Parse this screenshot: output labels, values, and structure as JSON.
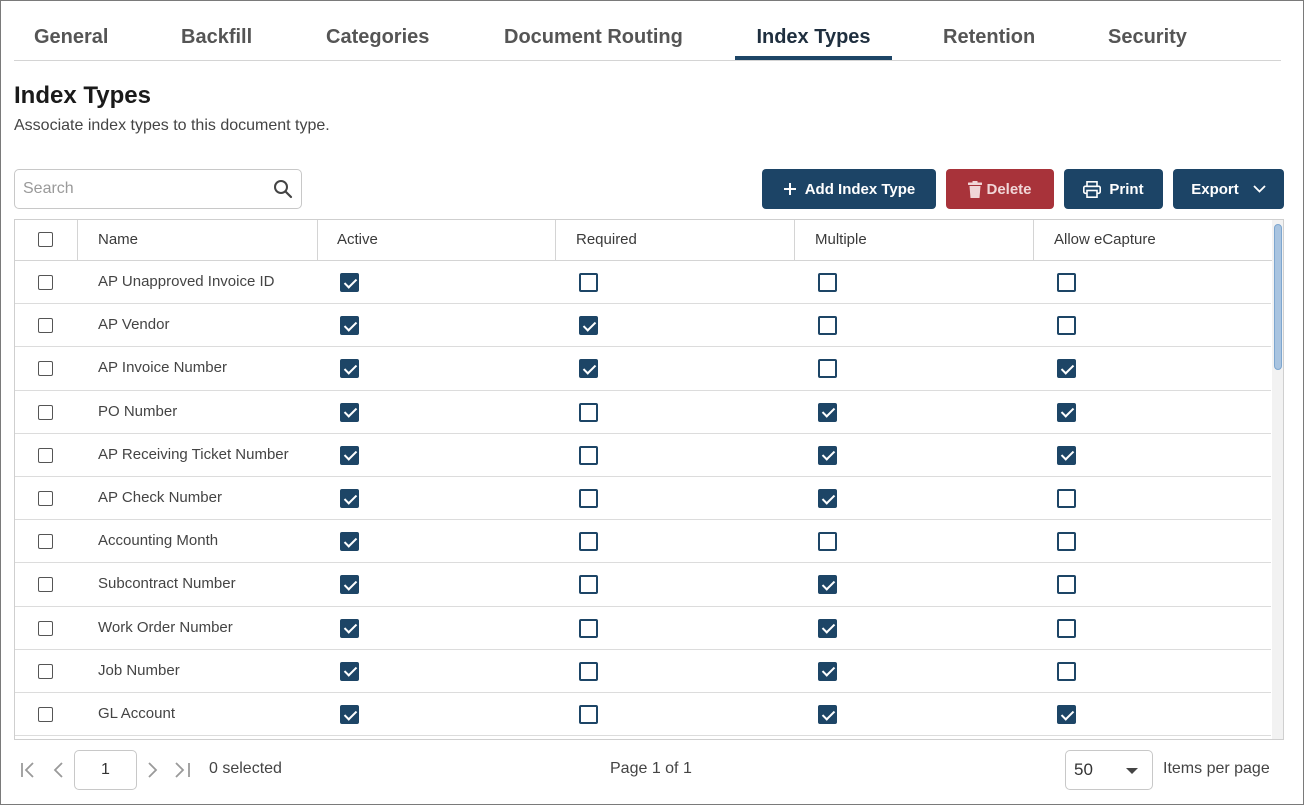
{
  "tabs": [
    {
      "label": "General",
      "active": false
    },
    {
      "label": "Backfill",
      "active": false
    },
    {
      "label": "Categories",
      "active": false
    },
    {
      "label": "Document Routing",
      "active": false
    },
    {
      "label": "Index Types",
      "active": true
    },
    {
      "label": "Retention",
      "active": false
    },
    {
      "label": "Security",
      "active": false
    }
  ],
  "header": {
    "title": "Index Types",
    "subtitle": "Associate index types to this document type."
  },
  "search": {
    "placeholder": "Search",
    "value": "",
    "icon": "search-icon"
  },
  "toolbar": {
    "add_label": "Add Index Type",
    "delete_label": "Delete",
    "print_label": "Print",
    "export_label": "Export"
  },
  "colors": {
    "primary": "#1c4466",
    "danger": "#a8333a",
    "checkbox": "#1d4566"
  },
  "grid": {
    "columns": [
      "Name",
      "Active",
      "Required",
      "Multiple",
      "Allow eCapture"
    ],
    "rows": [
      {
        "name": "AP Unapproved Invoice ID",
        "active": true,
        "required": false,
        "multiple": false,
        "ecapture": false
      },
      {
        "name": "AP Vendor",
        "active": true,
        "required": true,
        "multiple": false,
        "ecapture": false
      },
      {
        "name": "AP Invoice Number",
        "active": true,
        "required": true,
        "multiple": false,
        "ecapture": true
      },
      {
        "name": "PO Number",
        "active": true,
        "required": false,
        "multiple": true,
        "ecapture": true
      },
      {
        "name": "AP Receiving Ticket Number",
        "active": true,
        "required": false,
        "multiple": true,
        "ecapture": true
      },
      {
        "name": "AP Check Number",
        "active": true,
        "required": false,
        "multiple": true,
        "ecapture": false
      },
      {
        "name": "Accounting Month",
        "active": true,
        "required": false,
        "multiple": false,
        "ecapture": false
      },
      {
        "name": "Subcontract Number",
        "active": true,
        "required": false,
        "multiple": true,
        "ecapture": false
      },
      {
        "name": "Work Order Number",
        "active": true,
        "required": false,
        "multiple": true,
        "ecapture": false
      },
      {
        "name": "Job Number",
        "active": true,
        "required": false,
        "multiple": true,
        "ecapture": false
      },
      {
        "name": "GL Account",
        "active": true,
        "required": false,
        "multiple": true,
        "ecapture": true
      }
    ]
  },
  "pager": {
    "page_value": "1",
    "selected_text": "0 selected",
    "page_text": "Page 1 of 1",
    "per_page_value": "50",
    "per_page_label": "Items per page"
  }
}
